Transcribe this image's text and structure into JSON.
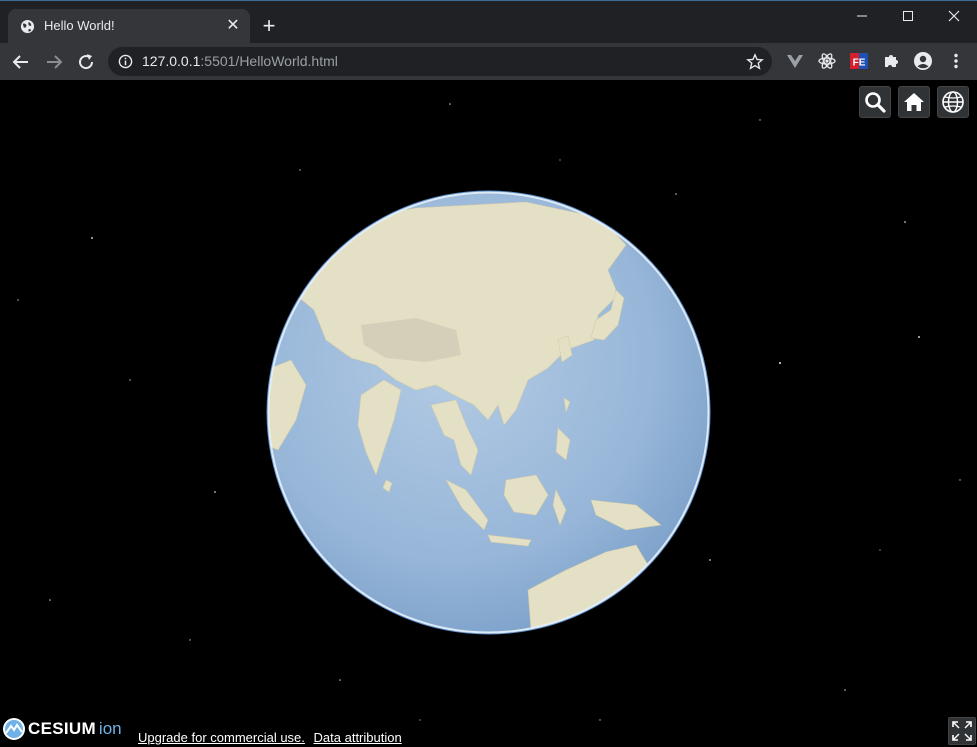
{
  "browser": {
    "tab": {
      "title": "Hello World!",
      "close_label": "✕"
    },
    "new_tab_label": "+",
    "address_bar": {
      "host": "127.0.0.1",
      "rest": ":5501/HelloWorld.html"
    },
    "extensions": [
      "vue-devtools-icon",
      "react-devtools-icon",
      "fe-helper-icon",
      "extensions-puzzle-icon",
      "profile-icon",
      "menu-dots-icon"
    ]
  },
  "viewer": {
    "toolbar_buttons": [
      "search-icon",
      "home-icon",
      "globe-icon"
    ],
    "credits": {
      "logo_word": "CESIUM",
      "logo_suffix": "ion",
      "upgrade_link": "Upgrade for commercial use.",
      "attribution_link": "Data attribution"
    }
  },
  "colors": {
    "chrome_dark": "#202124",
    "chrome_tab": "#35363a",
    "ion_blue": "#6fb2e8",
    "ocean": "#9ab8d8",
    "land": "#e6e2c8"
  }
}
